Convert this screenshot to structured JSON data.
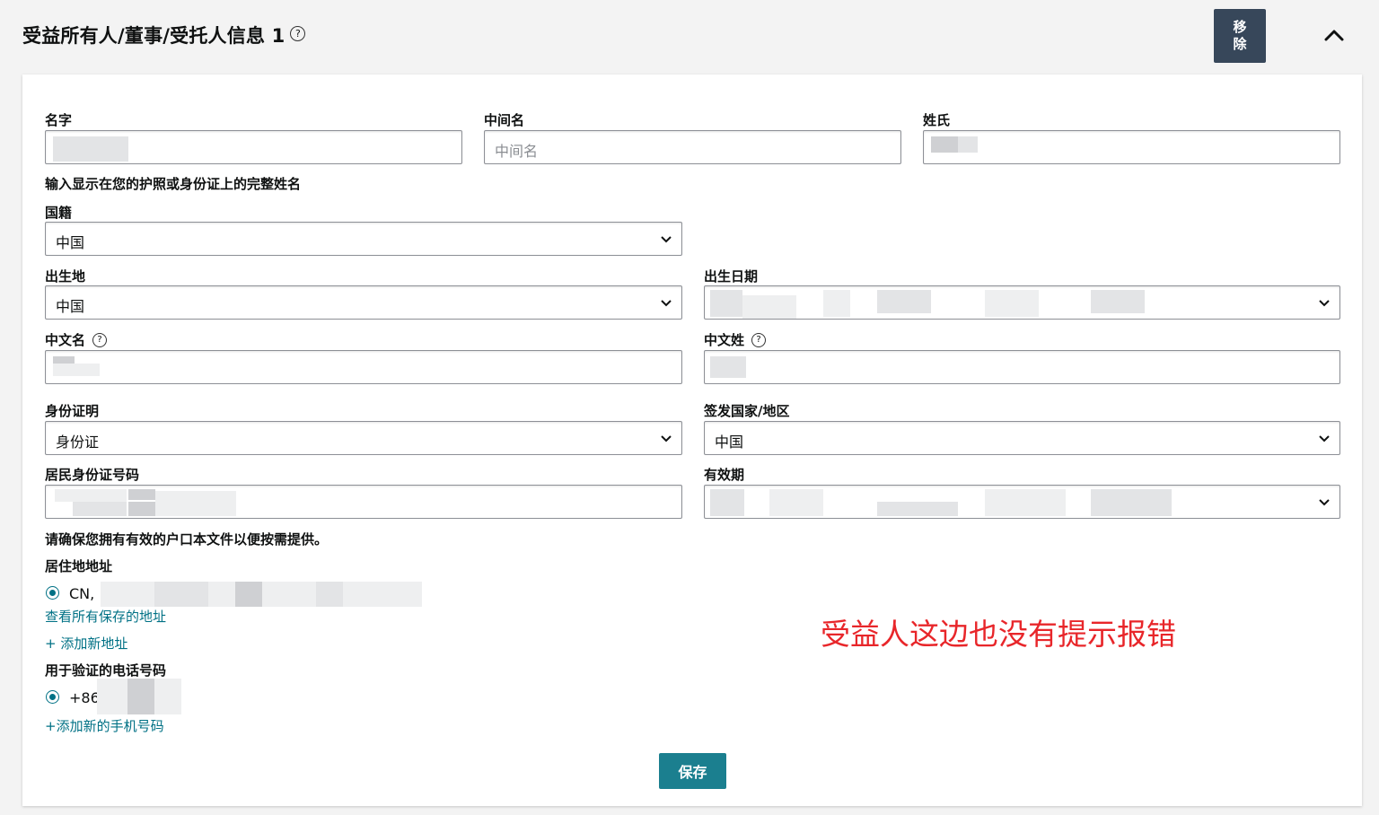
{
  "header": {
    "title": "受益所有人/董事/受托人信息 1",
    "help_glyph": "?",
    "remove_label_1": "移",
    "remove_label_2": "除"
  },
  "form": {
    "first_name_label": "名字",
    "middle_name_label": "中间名",
    "middle_name_placeholder": "中间名",
    "last_name_label": "姓氏",
    "name_hint": "输入显示在您的护照或身份证上的完整姓名",
    "nationality_label": "国籍",
    "nationality_value": "中国",
    "birthplace_label": "出生地",
    "birthplace_value": "中国",
    "birthdate_label": "出生日期",
    "cn_first_label": "中文名",
    "cn_last_label": "中文姓",
    "id_doc_label": "身份证明",
    "id_doc_value": "身份证",
    "issue_country_label": "签发国家/地区",
    "issue_country_value": "中国",
    "id_number_label": "居民身份证号码",
    "expiry_label": "有效期",
    "hukou_hint": "请确保您拥有有效的户口本文件以便按需提供。",
    "address_label": "居住地地址",
    "address_prefix": "CN,",
    "view_addresses_link": "查看所有保存的地址",
    "add_address_link": "+ 添加新地址",
    "phone_label": "用于验证的电话号码",
    "phone_prefix": "+86",
    "add_phone_link": "+添加新的手机号码",
    "save_label": "保存"
  },
  "annotation": "受益人这边也没有提示报错",
  "colors": {
    "accent": "#007185",
    "button": "#1b7f8f",
    "dark_button": "#37475a",
    "annotation": "#e8262a"
  }
}
